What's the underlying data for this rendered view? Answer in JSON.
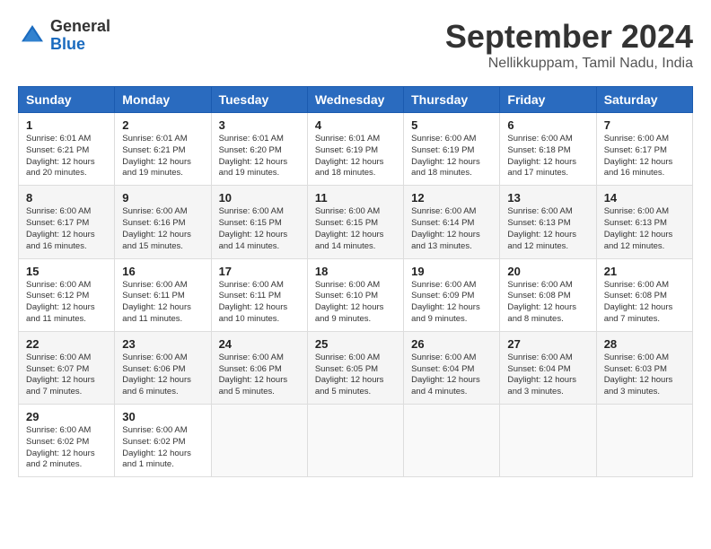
{
  "header": {
    "logo_general": "General",
    "logo_blue": "Blue",
    "month_title": "September 2024",
    "location": "Nellikkuppam, Tamil Nadu, India"
  },
  "calendar": {
    "days_of_week": [
      "Sunday",
      "Monday",
      "Tuesday",
      "Wednesday",
      "Thursday",
      "Friday",
      "Saturday"
    ],
    "weeks": [
      [
        {
          "day": "1",
          "sunrise": "6:01 AM",
          "sunset": "6:21 PM",
          "daylight": "12 hours and 20 minutes."
        },
        {
          "day": "2",
          "sunrise": "6:01 AM",
          "sunset": "6:21 PM",
          "daylight": "12 hours and 19 minutes."
        },
        {
          "day": "3",
          "sunrise": "6:01 AM",
          "sunset": "6:20 PM",
          "daylight": "12 hours and 19 minutes."
        },
        {
          "day": "4",
          "sunrise": "6:01 AM",
          "sunset": "6:19 PM",
          "daylight": "12 hours and 18 minutes."
        },
        {
          "day": "5",
          "sunrise": "6:00 AM",
          "sunset": "6:19 PM",
          "daylight": "12 hours and 18 minutes."
        },
        {
          "day": "6",
          "sunrise": "6:00 AM",
          "sunset": "6:18 PM",
          "daylight": "12 hours and 17 minutes."
        },
        {
          "day": "7",
          "sunrise": "6:00 AM",
          "sunset": "6:17 PM",
          "daylight": "12 hours and 16 minutes."
        }
      ],
      [
        {
          "day": "8",
          "sunrise": "6:00 AM",
          "sunset": "6:17 PM",
          "daylight": "12 hours and 16 minutes."
        },
        {
          "day": "9",
          "sunrise": "6:00 AM",
          "sunset": "6:16 PM",
          "daylight": "12 hours and 15 minutes."
        },
        {
          "day": "10",
          "sunrise": "6:00 AM",
          "sunset": "6:15 PM",
          "daylight": "12 hours and 14 minutes."
        },
        {
          "day": "11",
          "sunrise": "6:00 AM",
          "sunset": "6:15 PM",
          "daylight": "12 hours and 14 minutes."
        },
        {
          "day": "12",
          "sunrise": "6:00 AM",
          "sunset": "6:14 PM",
          "daylight": "12 hours and 13 minutes."
        },
        {
          "day": "13",
          "sunrise": "6:00 AM",
          "sunset": "6:13 PM",
          "daylight": "12 hours and 12 minutes."
        },
        {
          "day": "14",
          "sunrise": "6:00 AM",
          "sunset": "6:13 PM",
          "daylight": "12 hours and 12 minutes."
        }
      ],
      [
        {
          "day": "15",
          "sunrise": "6:00 AM",
          "sunset": "6:12 PM",
          "daylight": "12 hours and 11 minutes."
        },
        {
          "day": "16",
          "sunrise": "6:00 AM",
          "sunset": "6:11 PM",
          "daylight": "12 hours and 11 minutes."
        },
        {
          "day": "17",
          "sunrise": "6:00 AM",
          "sunset": "6:11 PM",
          "daylight": "12 hours and 10 minutes."
        },
        {
          "day": "18",
          "sunrise": "6:00 AM",
          "sunset": "6:10 PM",
          "daylight": "12 hours and 9 minutes."
        },
        {
          "day": "19",
          "sunrise": "6:00 AM",
          "sunset": "6:09 PM",
          "daylight": "12 hours and 9 minutes."
        },
        {
          "day": "20",
          "sunrise": "6:00 AM",
          "sunset": "6:08 PM",
          "daylight": "12 hours and 8 minutes."
        },
        {
          "day": "21",
          "sunrise": "6:00 AM",
          "sunset": "6:08 PM",
          "daylight": "12 hours and 7 minutes."
        }
      ],
      [
        {
          "day": "22",
          "sunrise": "6:00 AM",
          "sunset": "6:07 PM",
          "daylight": "12 hours and 7 minutes."
        },
        {
          "day": "23",
          "sunrise": "6:00 AM",
          "sunset": "6:06 PM",
          "daylight": "12 hours and 6 minutes."
        },
        {
          "day": "24",
          "sunrise": "6:00 AM",
          "sunset": "6:06 PM",
          "daylight": "12 hours and 5 minutes."
        },
        {
          "day": "25",
          "sunrise": "6:00 AM",
          "sunset": "6:05 PM",
          "daylight": "12 hours and 5 minutes."
        },
        {
          "day": "26",
          "sunrise": "6:00 AM",
          "sunset": "6:04 PM",
          "daylight": "12 hours and 4 minutes."
        },
        {
          "day": "27",
          "sunrise": "6:00 AM",
          "sunset": "6:04 PM",
          "daylight": "12 hours and 3 minutes."
        },
        {
          "day": "28",
          "sunrise": "6:00 AM",
          "sunset": "6:03 PM",
          "daylight": "12 hours and 3 minutes."
        }
      ],
      [
        {
          "day": "29",
          "sunrise": "6:00 AM",
          "sunset": "6:02 PM",
          "daylight": "12 hours and 2 minutes."
        },
        {
          "day": "30",
          "sunrise": "6:00 AM",
          "sunset": "6:02 PM",
          "daylight": "12 hours and 1 minute."
        },
        null,
        null,
        null,
        null,
        null
      ]
    ]
  }
}
